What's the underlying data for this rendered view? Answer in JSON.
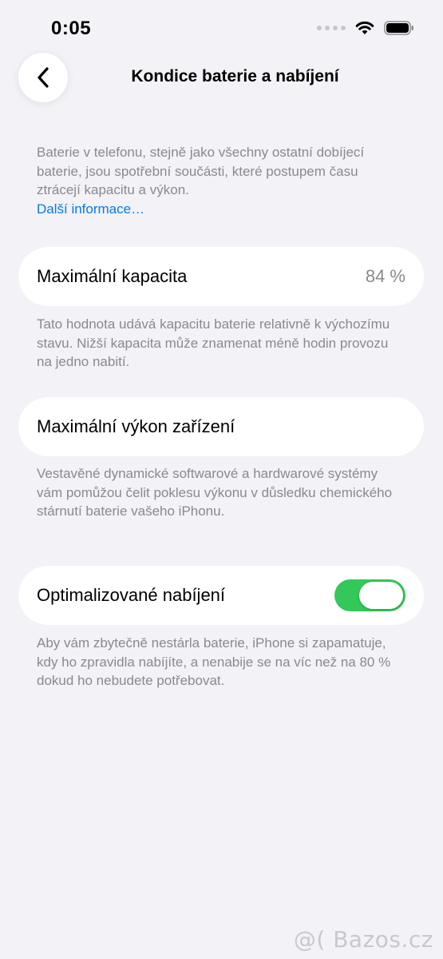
{
  "status_bar": {
    "time": "0:05"
  },
  "nav": {
    "title": "Kondice baterie a nabíjení"
  },
  "intro": {
    "text": "Baterie v telefonu, stejně jako všechny ostatní dobíjecí baterie, jsou spotřební součásti, které postupem času ztrácejí kapacitu a výkon.",
    "link": "Další informace…"
  },
  "max_capacity": {
    "label": "Maximální kapacita",
    "value": "84 %",
    "footer": "Tato hodnota udává kapacitu baterie relativně k výchozímu stavu. Nižší kapacita může znamenat méně hodin provozu na jedno nabití."
  },
  "peak_performance": {
    "label": "Maximální výkon zařízení",
    "footer": "Vestavěné dynamické softwarové a hardwarové systémy vám pomůžou čelit poklesu výkonu v důsledku chemického stárnutí baterie vašeho iPhonu."
  },
  "optimized_charging": {
    "label": "Optimalizované nabíjení",
    "enabled": true,
    "footer": "Aby vám zbytečně nestárla baterie, iPhone si zapamatuje, kdy ho zpravidla nabíjíte, a nenabije se na víc než na 80 % dokud ho nebudete potřebovat."
  },
  "watermark": "@( Bazos.cz",
  "colors": {
    "background": "#F2F2F7",
    "toggle_on": "#34C759",
    "link": "#0A7AE0"
  },
  "icons": [
    "chevron-left-icon",
    "wifi-icon",
    "battery-icon",
    "cellular-signal-icon"
  ]
}
